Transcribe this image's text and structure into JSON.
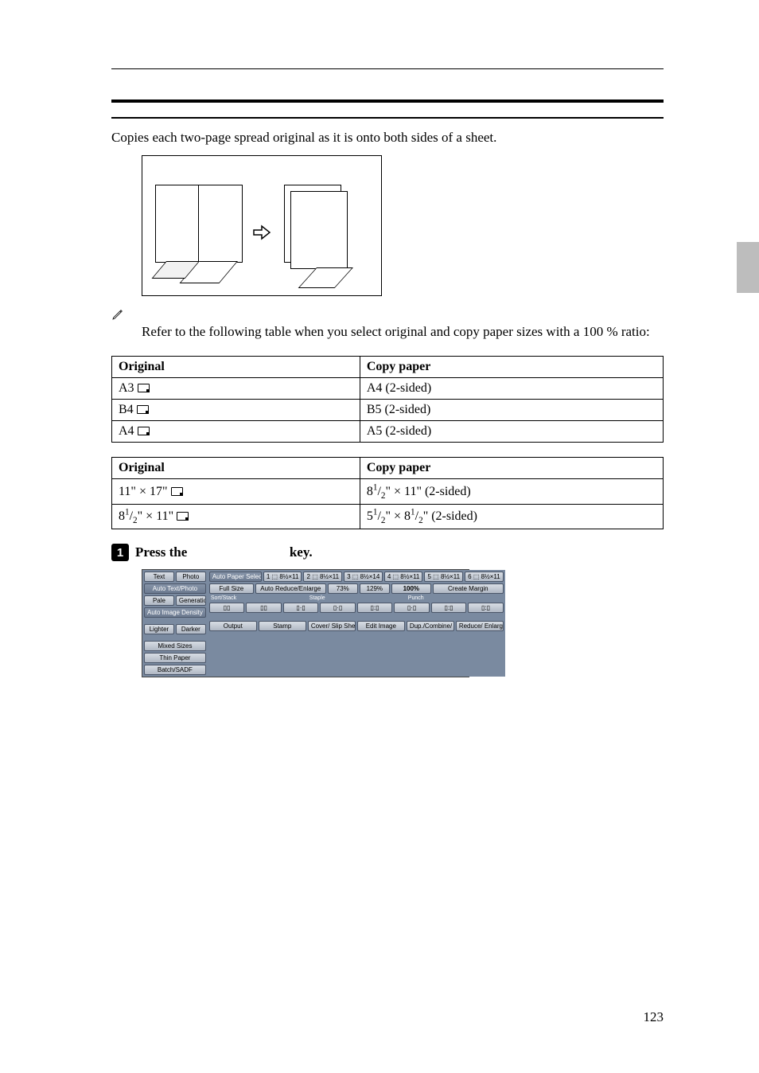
{
  "intro": "Copies each two-page spread original as it is onto both sides of a sheet.",
  "note": "Refer to the following table when you select original and copy paper sizes with a 100 % ratio:",
  "table_a": {
    "headers": [
      "Original",
      "Copy paper"
    ],
    "rows": [
      {
        "orig": "A3",
        "copy": "A4 (2-sided)"
      },
      {
        "orig": "B4",
        "copy": "B5 (2-sided)"
      },
      {
        "orig": "A4",
        "copy": "A5 (2-sided)"
      }
    ]
  },
  "table_b": {
    "headers": [
      "Original",
      "Copy paper"
    ],
    "rows": [
      {
        "orig_html": "11\"&nbsp;&times;&nbsp;17\"",
        "copy_html": "8<span class='sup'>1</span>/<span class='sub'>2</span>\"&nbsp;&times;&nbsp;11\" (2-sided)"
      },
      {
        "orig_html": "8<span class='sup'>1</span>/<span class='sub'>2</span>\"&nbsp;&times;&nbsp;11\"",
        "copy_html": "5<span class='sup'>1</span>/<span class='sub'>2</span>\"&nbsp;&times;&nbsp;8<span class='sup'>1</span>/<span class='sub'>2</span>\" (2-sided)"
      }
    ]
  },
  "step1": {
    "num": "1",
    "before": "Press the ",
    "after": " key."
  },
  "shot": {
    "left": {
      "tabs": [
        "Text",
        "Photo"
      ],
      "btn_autoTextPhoto": "Auto Text/Photo",
      "row2": [
        "Pale",
        "Generation"
      ],
      "btn_autoImgDensity": "Auto Image Density",
      "row3": [
        "Lighter",
        "Darker"
      ],
      "btn_mixed": "Mixed Sizes",
      "btn_thin": "Thin Paper",
      "btn_batch": "Batch/SADF"
    },
    "right": {
      "paperSelect": "Auto Paper Select",
      "trays": [
        "1 ⬚ 8½×11",
        "2 ⬚ 8½×11",
        "3 ⬚ 8½×14",
        "4 ⬚ 8½×11",
        "5 ⬚ 8½×11",
        "6 ⬚ 8½×11"
      ],
      "row2": [
        "Full Size",
        "Auto Reduce/Enlarge",
        "73%",
        "129%",
        "100%",
        "Create Margin"
      ],
      "lbl_sort": "Sort/Stack",
      "lbl_staple": "Staple",
      "lbl_punch": "Punch",
      "bottom": [
        "Output",
        "Stamp",
        "Cover/ Slip Sheet",
        "Edit Image",
        "Dup./Combine/ Series",
        "Reduce/ Enlarge"
      ]
    }
  },
  "page_number": "123"
}
